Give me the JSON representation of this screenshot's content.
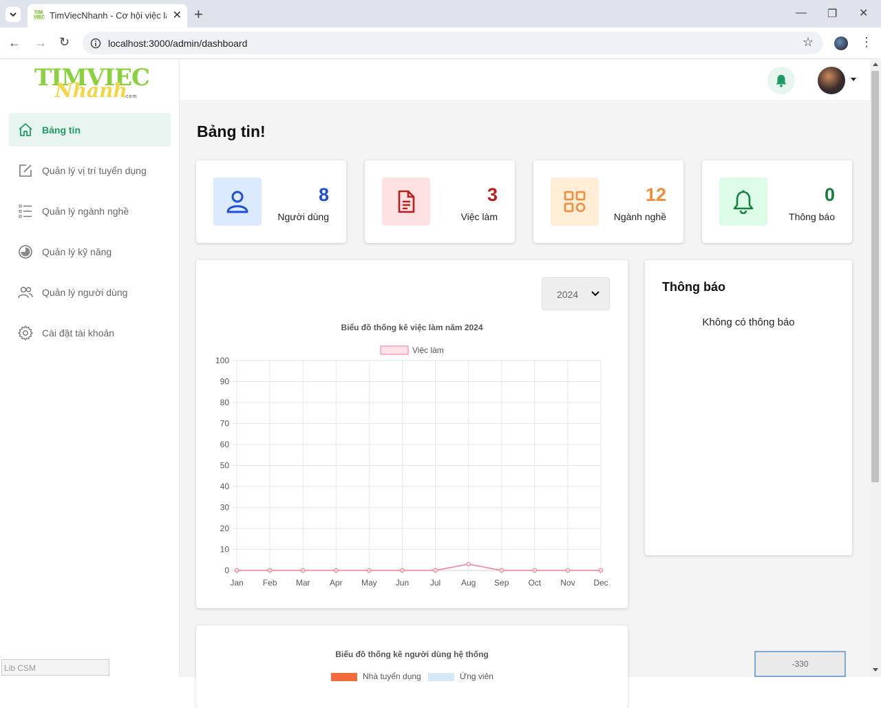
{
  "browser": {
    "tab_title": "TimViecNhanh - Cơ hội việc làm",
    "url": "localhost:3000/admin/dashboard",
    "favicon_text": "TIM VIEC"
  },
  "logo": {
    "line1": "TIMVIEC",
    "line2": "Nhanh",
    "suffix": ".com"
  },
  "sidebar": {
    "items": [
      {
        "label": "Bảng tin",
        "icon": "home-icon",
        "active": true
      },
      {
        "label": "Quản lý vị trí tuyển dụng",
        "icon": "edit-icon"
      },
      {
        "label": "Quản lý ngành nghề",
        "icon": "list-icon"
      },
      {
        "label": "Quản lý kỹ năng",
        "icon": "pie-icon"
      },
      {
        "label": "Quản lý người dùng",
        "icon": "users-icon"
      },
      {
        "label": "Cài đặt tài khoản",
        "icon": "gear-icon"
      }
    ]
  },
  "lib_csm": "Lib CSM",
  "page_title": "Bảng tin!",
  "stats": [
    {
      "value": "8",
      "label": "Người dùng",
      "color": "#1d4ed8",
      "bg": "#dbeafe",
      "icon": "user-icon"
    },
    {
      "value": "3",
      "label": "Việc làm",
      "color": "#b91c1c",
      "bg": "#fee2e2",
      "icon": "document-icon"
    },
    {
      "value": "12",
      "label": "Ngành nghề",
      "color": "#f28c38",
      "bg": "#ffedd5",
      "icon": "grid-icon"
    },
    {
      "value": "0",
      "label": "Thông báo",
      "color": "#15803d",
      "bg": "#dcfce7",
      "icon": "bell-icon"
    }
  ],
  "year_select": {
    "value": "2024"
  },
  "notifications": {
    "title": "Thông báo",
    "empty": "Không có thông báo"
  },
  "chart2": {
    "title": "Biểu đồ thống kê người dùng hệ thống",
    "legend": [
      "Nhà tuyển dụng",
      "Ứng viên"
    ]
  },
  "scroll_box": "-330",
  "chart_data": {
    "type": "line",
    "title": "Biểu đồ thống kê việc làm năm 2024",
    "categories": [
      "Jan",
      "Feb",
      "Mar",
      "Apr",
      "May",
      "Jun",
      "Jul",
      "Aug",
      "Sep",
      "Oct",
      "Nov",
      "Dec"
    ],
    "series": [
      {
        "name": "Việc làm",
        "values": [
          0,
          0,
          0,
          0,
          0,
          0,
          0,
          3,
          0,
          0,
          0,
          0
        ],
        "color": "#f27b94"
      }
    ],
    "ylim": [
      0,
      100
    ],
    "yticks": [
      0,
      10,
      20,
      30,
      40,
      50,
      60,
      70,
      80,
      90,
      100
    ],
    "grid": true,
    "legend": "top"
  }
}
